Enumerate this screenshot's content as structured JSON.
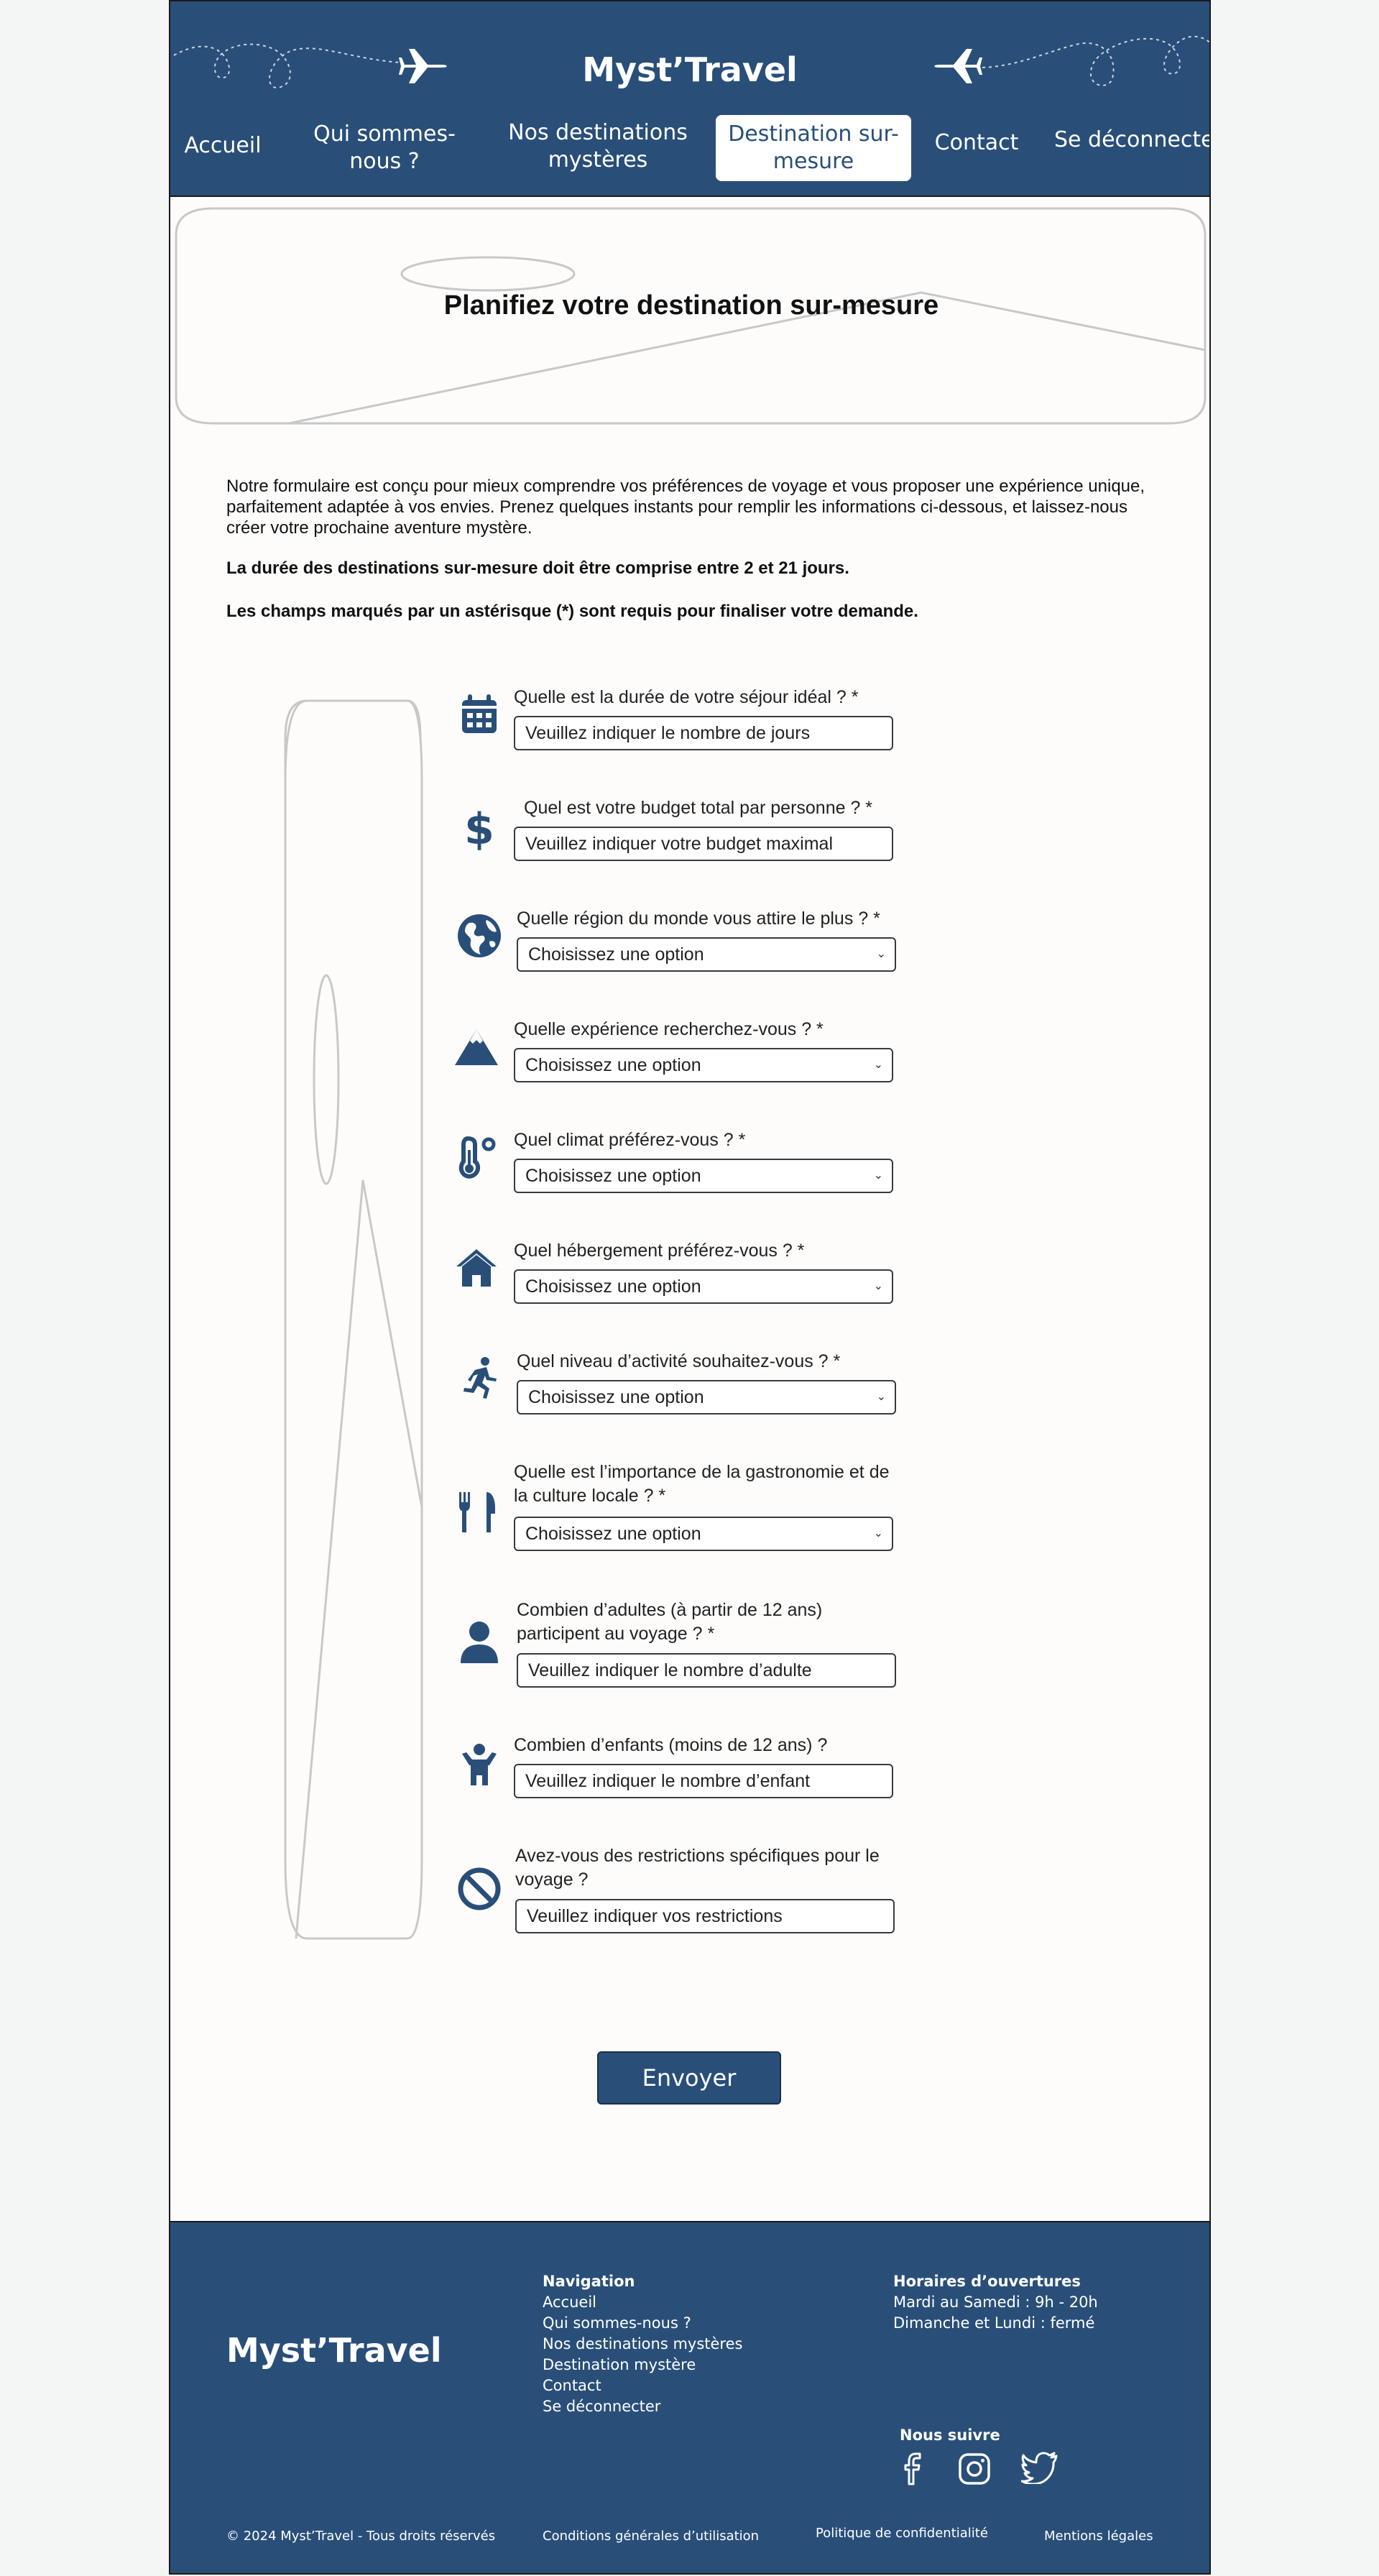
{
  "header": {
    "brand": "Myst’Travel",
    "nav": [
      {
        "label": "Accueil"
      },
      {
        "label": "Qui sommes-nous ?"
      },
      {
        "label": "Nos destinations mystères"
      },
      {
        "label": "Destination sur-mesure",
        "active": true
      },
      {
        "label": "Contact"
      },
      {
        "label": "Se déconnecter"
      }
    ]
  },
  "hero": {
    "title": "Planifiez votre destination sur-mesure"
  },
  "intro": {
    "paragraph": "Notre formulaire est conçu pour mieux comprendre vos préférences de voyage et vous proposer une expérience unique, parfaitement adaptée à vos envies. Prenez quelques instants pour remplir les informations ci-dessous, et laissez-nous créer votre prochaine aventure mystère.",
    "duration_note": "La durée des destinations sur-mesure doit être comprise entre 2 et 21 jours.",
    "required_note": "Les champs marqués par un astérisque (*) sont requis pour finaliser votre demande."
  },
  "form": {
    "questions": [
      {
        "icon": "calendar-icon",
        "label": "Quelle est la durée de votre séjour idéal ? *",
        "type": "input",
        "placeholder": "Veuillez indiquer le nombre de jours"
      },
      {
        "icon": "dollar-icon",
        "label": "Quel est votre budget total par personne ? *",
        "type": "input",
        "placeholder": "Veuillez indiquer votre budget maximal"
      },
      {
        "icon": "globe-icon",
        "label": "Quelle région du monde vous attire le plus ? *",
        "type": "select",
        "value": "Choisissez une option"
      },
      {
        "icon": "mountain-icon",
        "label": "Quelle expérience recherchez-vous ? *",
        "type": "select",
        "value": "Choisissez une option"
      },
      {
        "icon": "thermometer-icon",
        "label": "Quel climat préférez-vous ? *",
        "type": "select",
        "value": "Choisissez une option"
      },
      {
        "icon": "house-icon",
        "label": "Quel hébergement préférez-vous ? *",
        "type": "select",
        "value": "Choisissez une option"
      },
      {
        "icon": "running-person-icon",
        "label": "Quel niveau d’activité souhaitez-vous ? *",
        "type": "select",
        "value": "Choisissez une option"
      },
      {
        "icon": "utensils-icon",
        "label": "Quelle est l’importance de la gastronomie et de la culture locale ? *",
        "type": "select",
        "value": "Choisissez une option"
      },
      {
        "icon": "user-icon",
        "label": "Combien d’adultes (à partir de 12 ans) participent au voyage ? *",
        "type": "input",
        "placeholder": "Veuillez indiquer le nombre d’adulte"
      },
      {
        "icon": "child-icon",
        "label": "Combien d’enfants (moins de 12 ans) ?",
        "type": "input",
        "placeholder": "Veuillez indiquer le nombre d’enfant"
      },
      {
        "icon": "ban-icon",
        "label": "Avez-vous des restrictions spécifiques pour le voyage ?",
        "type": "input",
        "placeholder": "Veuillez indiquer vos restrictions"
      }
    ],
    "submit_label": "Envoyer"
  },
  "footer": {
    "brand": "Myst’Travel",
    "navigation_title": "Navigation",
    "navigation_links": [
      "Accueil",
      "Qui sommes-nous ?",
      "Nos destinations mystères",
      "Destination mystère",
      "Contact",
      "Se déconnecter"
    ],
    "hours_title": "Horaires d’ouvertures",
    "hours": [
      "Mardi au Samedi : 9h - 20h",
      "Dimanche et Lundi : fermé"
    ],
    "follow_title": "Nous suivre",
    "social": [
      "facebook-icon",
      "instagram-icon",
      "twitter-icon"
    ],
    "copyright": "© 2024 Myst’Travel - Tous droits réservés",
    "legal_links": [
      "Conditions générales d’utilisation",
      "Politique de confidentialité",
      "Mentions légales"
    ]
  },
  "colors": {
    "primary": "#294f79",
    "page_bg": "#fdfcfb",
    "outer_bg": "#f4f5f5"
  }
}
